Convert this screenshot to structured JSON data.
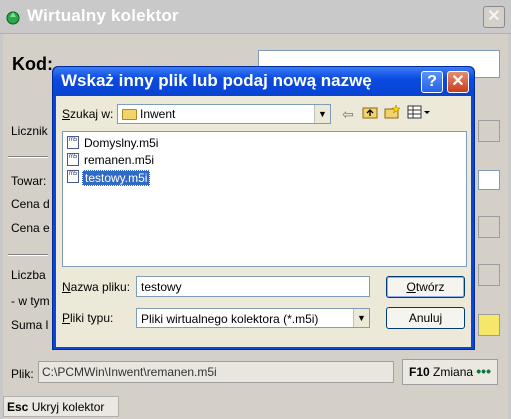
{
  "main_window": {
    "title": "Wirtualny kolektor",
    "close_glyph": "✕",
    "kod_label": "Kod:",
    "labels": {
      "licznik": "Licznik",
      "towar": "Towar:",
      "cena_d": "Cena d",
      "cena_e": "Cena e",
      "liczba": "Liczba",
      "w_tym": "- w tym",
      "suma": "Suma l"
    },
    "plik_label": "Plik:",
    "plik_path": "C:\\PCMWin\\Inwent\\remanen.m5i",
    "f10_key": "F10",
    "f10_label": "Zmiana",
    "f10_dots": "•••",
    "esc_key": "Esc",
    "esc_label": "Ukryj kolektor"
  },
  "dialog": {
    "title": "Wskaż inny plik lub podaj nową nazwę",
    "help_glyph": "?",
    "close_glyph": "✕",
    "look_in_label": "Szukaj w:",
    "look_in_value": "Inwent",
    "files": [
      {
        "name": "Domyslny.m5i",
        "selected": false
      },
      {
        "name": "remanen.m5i",
        "selected": false
      },
      {
        "name": "testowy.m5i",
        "selected": true
      }
    ],
    "file_name_label": "Nazwa pliku:",
    "file_name_value": "testowy",
    "file_type_label": "Pliki typu:",
    "file_type_value": "Pliki wirtualnego kolektora (*.m5i)",
    "open_button": "Otwórz",
    "cancel_button": "Anuluj"
  },
  "colors": {
    "dialog_title": "#0b4be0",
    "selection": "#316ac5",
    "window_face": "#d4d0c8"
  },
  "icons": [
    "app-icon",
    "folder-icon",
    "back-icon",
    "up-folder-icon",
    "new-folder-icon",
    "view-menu-icon",
    "file-icon"
  ]
}
